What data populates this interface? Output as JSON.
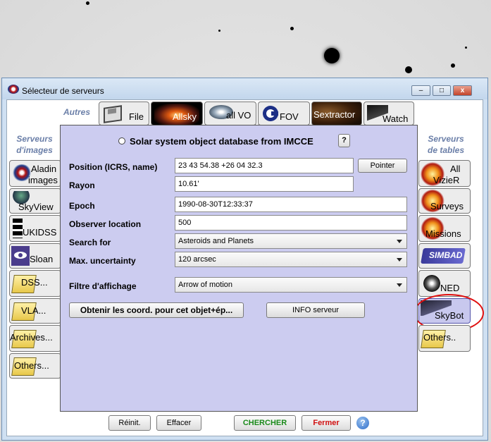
{
  "window": {
    "title": "Sélecteur de serveurs",
    "controls": {
      "minimize": "–",
      "maximize": "□",
      "close": "x"
    }
  },
  "sections": {
    "others": "Autres",
    "image_servers": [
      "Serveurs",
      "d'images"
    ],
    "table_servers": [
      "Serveurs",
      "de tables"
    ]
  },
  "top_tabs": [
    {
      "label": "File",
      "icon": "floppy-icon"
    },
    {
      "label": "Allsky",
      "icon": "allsky-icon"
    },
    {
      "label": "all VO",
      "icon": "vo-icon"
    },
    {
      "label": "FOV",
      "icon": "fov-icon"
    },
    {
      "label": "Sextractor",
      "icon": "sextractor-icon"
    },
    {
      "label": "Watch",
      "icon": "telescope-icon"
    }
  ],
  "image_servers": [
    {
      "label": "Aladin images",
      "line1": "Aladin",
      "line2": "images",
      "icon": "aladin-icon"
    },
    {
      "label": "SkyView",
      "icon": "skyview-icon"
    },
    {
      "label": "UKIDSS",
      "icon": "ukidss-icon"
    },
    {
      "label": "Sloan",
      "icon": "sloan-icon"
    },
    {
      "label": "DSS...",
      "icon": "folder-icon"
    },
    {
      "label": "VLA...",
      "icon": "folder-icon"
    },
    {
      "label": "Archives...",
      "icon": "folder-icon"
    },
    {
      "label": "Others...",
      "icon": "folder-icon"
    }
  ],
  "table_servers": [
    {
      "label": "All VizieR",
      "line1": "All",
      "line2": "VizieR",
      "icon": "vizier-icon"
    },
    {
      "label": "Surveys",
      "icon": "vizier-icon"
    },
    {
      "label": "Missions",
      "icon": "vizier-icon"
    },
    {
      "label": "SIMBAD",
      "icon": "simbad-icon"
    },
    {
      "label": "NED",
      "icon": "ned-icon"
    },
    {
      "label": "SkyBot",
      "icon": "skybot-icon",
      "selected": true
    },
    {
      "label": "Others..",
      "icon": "folder-icon"
    }
  ],
  "form": {
    "title": "Solar system object database from IMCCE",
    "help": "?",
    "position_label": "Position (ICRS, name)",
    "position_value": "23 43 54.38 +26 04 32.3",
    "pointer_button": "Pointer",
    "radius_label": "Rayon",
    "radius_value": "10.61'",
    "epoch_label": "Epoch",
    "epoch_value": "1990-08-30T12:33:37",
    "observer_label": "Observer location",
    "observer_value": "500",
    "search_for_label": "Search for",
    "search_for_value": "Asteroids and Planets",
    "uncertainty_label": "Max. uncertainty",
    "uncertainty_value": "120 arcsec",
    "display_filter_label": "Filtre d'affichage",
    "display_filter_value": "Arrow of motion",
    "get_coords_button": "Obtenir les coord. pour cet objet+ép...",
    "info_button": "INFO serveur"
  },
  "bottom": {
    "reset": "Réinit.",
    "clear": "Effacer",
    "search": "CHERCHER",
    "close": "Fermer",
    "help": "?"
  },
  "colors": {
    "panel": "#ccccf0",
    "section_label": "#6b7fa8",
    "search_text": "#1a8a1a",
    "close_text": "#d01010",
    "highlight_circle": "#e01010"
  }
}
